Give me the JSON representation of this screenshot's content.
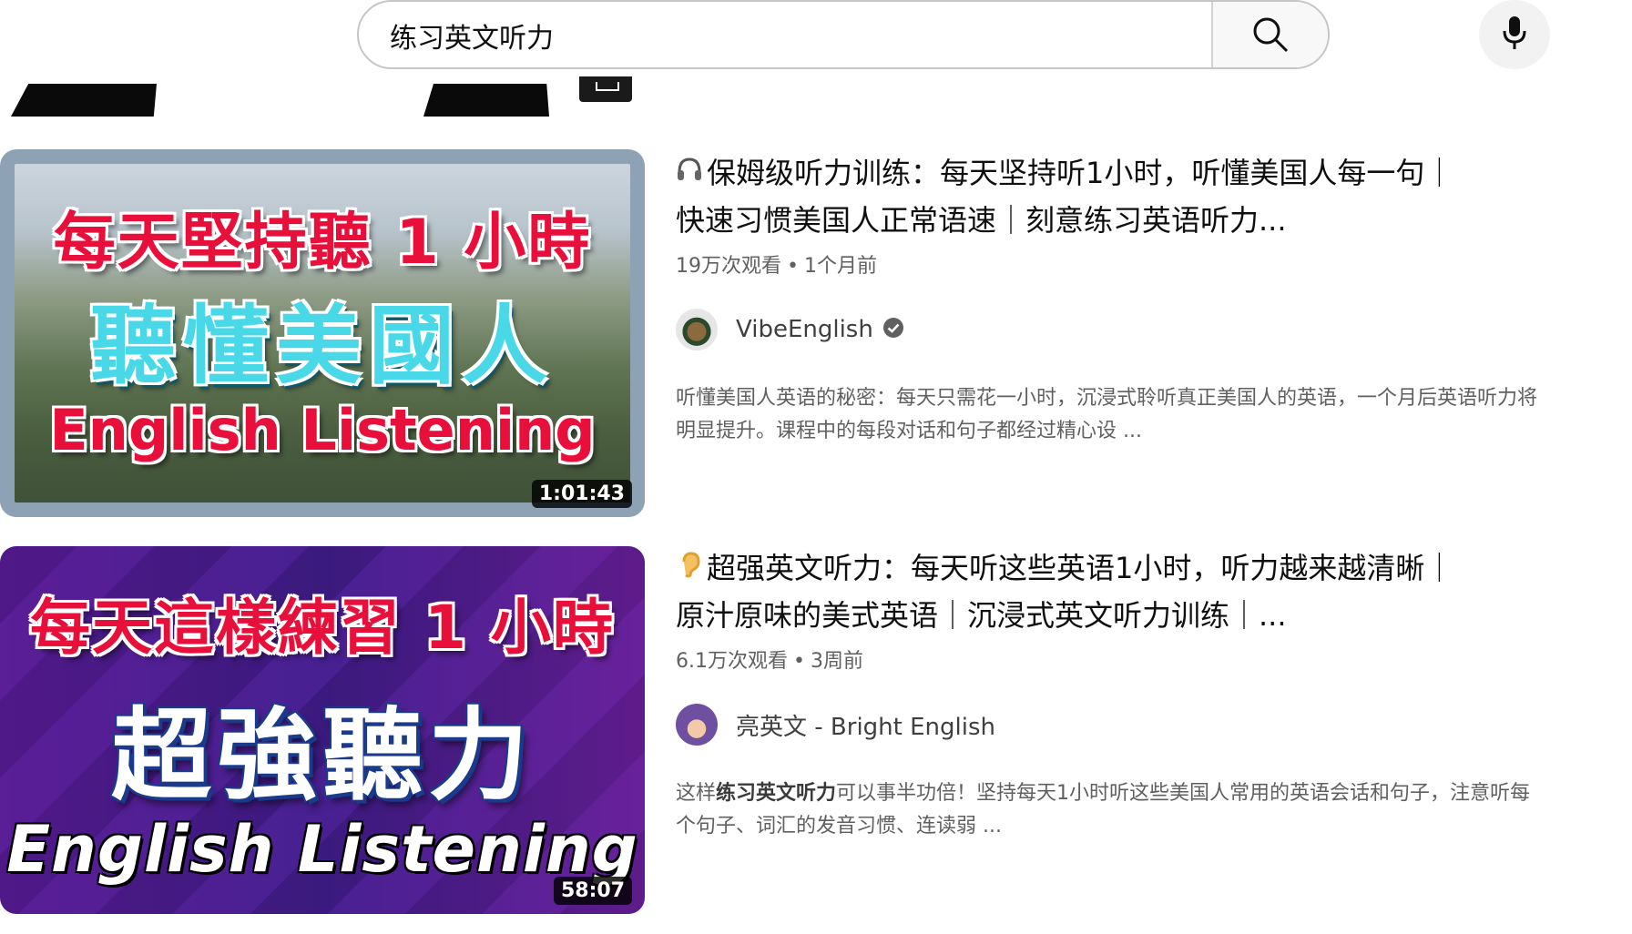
{
  "search": {
    "query": "练习英文听力",
    "clear_icon": "close-icon",
    "search_icon": "search-icon",
    "mic_icon": "microphone-icon"
  },
  "results": [
    {
      "thumbnail": {
        "line1": "每天堅持聽 1 小時",
        "line2": "聽懂美國人",
        "line3": "English Listening",
        "duration": "1:01:43",
        "frame_color": "#8ea2b6"
      },
      "title_icon": "headphones-icon",
      "title": "保姆级听力训练：每天坚持听1小时，听懂美国人每一句｜快速习惯美国人正常语速｜刻意练习英语听力...",
      "views": "19万次观看",
      "separator": "•",
      "age": "1个月前",
      "channel": "VibeEnglish",
      "verified_icon": "verified-check-icon",
      "description": "听懂美国人英语的秘密：每天只需花一小时，沉浸式聆听真正美国人的英语，一个月后英语听力将明显提升。课程中的每段对话和句子都经过精心设 ..."
    },
    {
      "thumbnail": {
        "line1": "每天這樣練習 1 小時",
        "line2": "超強聽力",
        "line3": "English Listening",
        "duration": "58:07"
      },
      "title_icon": "ear-icon",
      "title": "超强英文听力：每天听这些英语1小时，听力越来越清晰｜原汁原味的美式英语｜沉浸式英文听力训练｜...",
      "views": "6.1万次观看",
      "separator": "•",
      "age": "3周前",
      "channel": "亮英文 - Bright English",
      "description_prefix": "这样",
      "description_bold": "练习英文听力",
      "description_rest": "可以事半功倍！坚持每天1小时听这些美国人常用的英语会话和句子，注意听每个句子、词汇的发音习惯、连读弱 ..."
    }
  ]
}
